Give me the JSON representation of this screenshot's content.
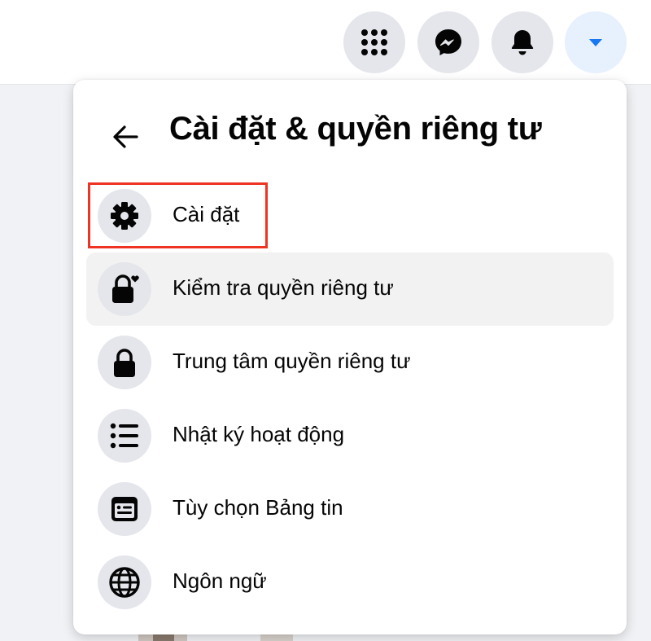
{
  "panel": {
    "title": "Cài đặt & quyền riêng tư",
    "items": [
      {
        "label": "Cài đặt",
        "icon": "gear-icon"
      },
      {
        "label": "Kiểm tra quyền riêng tư",
        "icon": "lock-heart-icon"
      },
      {
        "label": "Trung tâm quyền riêng tư",
        "icon": "lock-icon"
      },
      {
        "label": "Nhật ký hoạt động",
        "icon": "list-icon"
      },
      {
        "label": "Tùy chọn Bảng tin",
        "icon": "feed-icon"
      },
      {
        "label": "Ngôn ngữ",
        "icon": "globe-icon"
      }
    ]
  },
  "topbar": {
    "buttons": [
      "menu-grid-icon",
      "messenger-icon",
      "bell-icon",
      "caret-down-icon"
    ]
  },
  "colors": {
    "accent": "#1877f2",
    "highlight": "#ee3322",
    "icon_bg": "#e4e6eb"
  }
}
